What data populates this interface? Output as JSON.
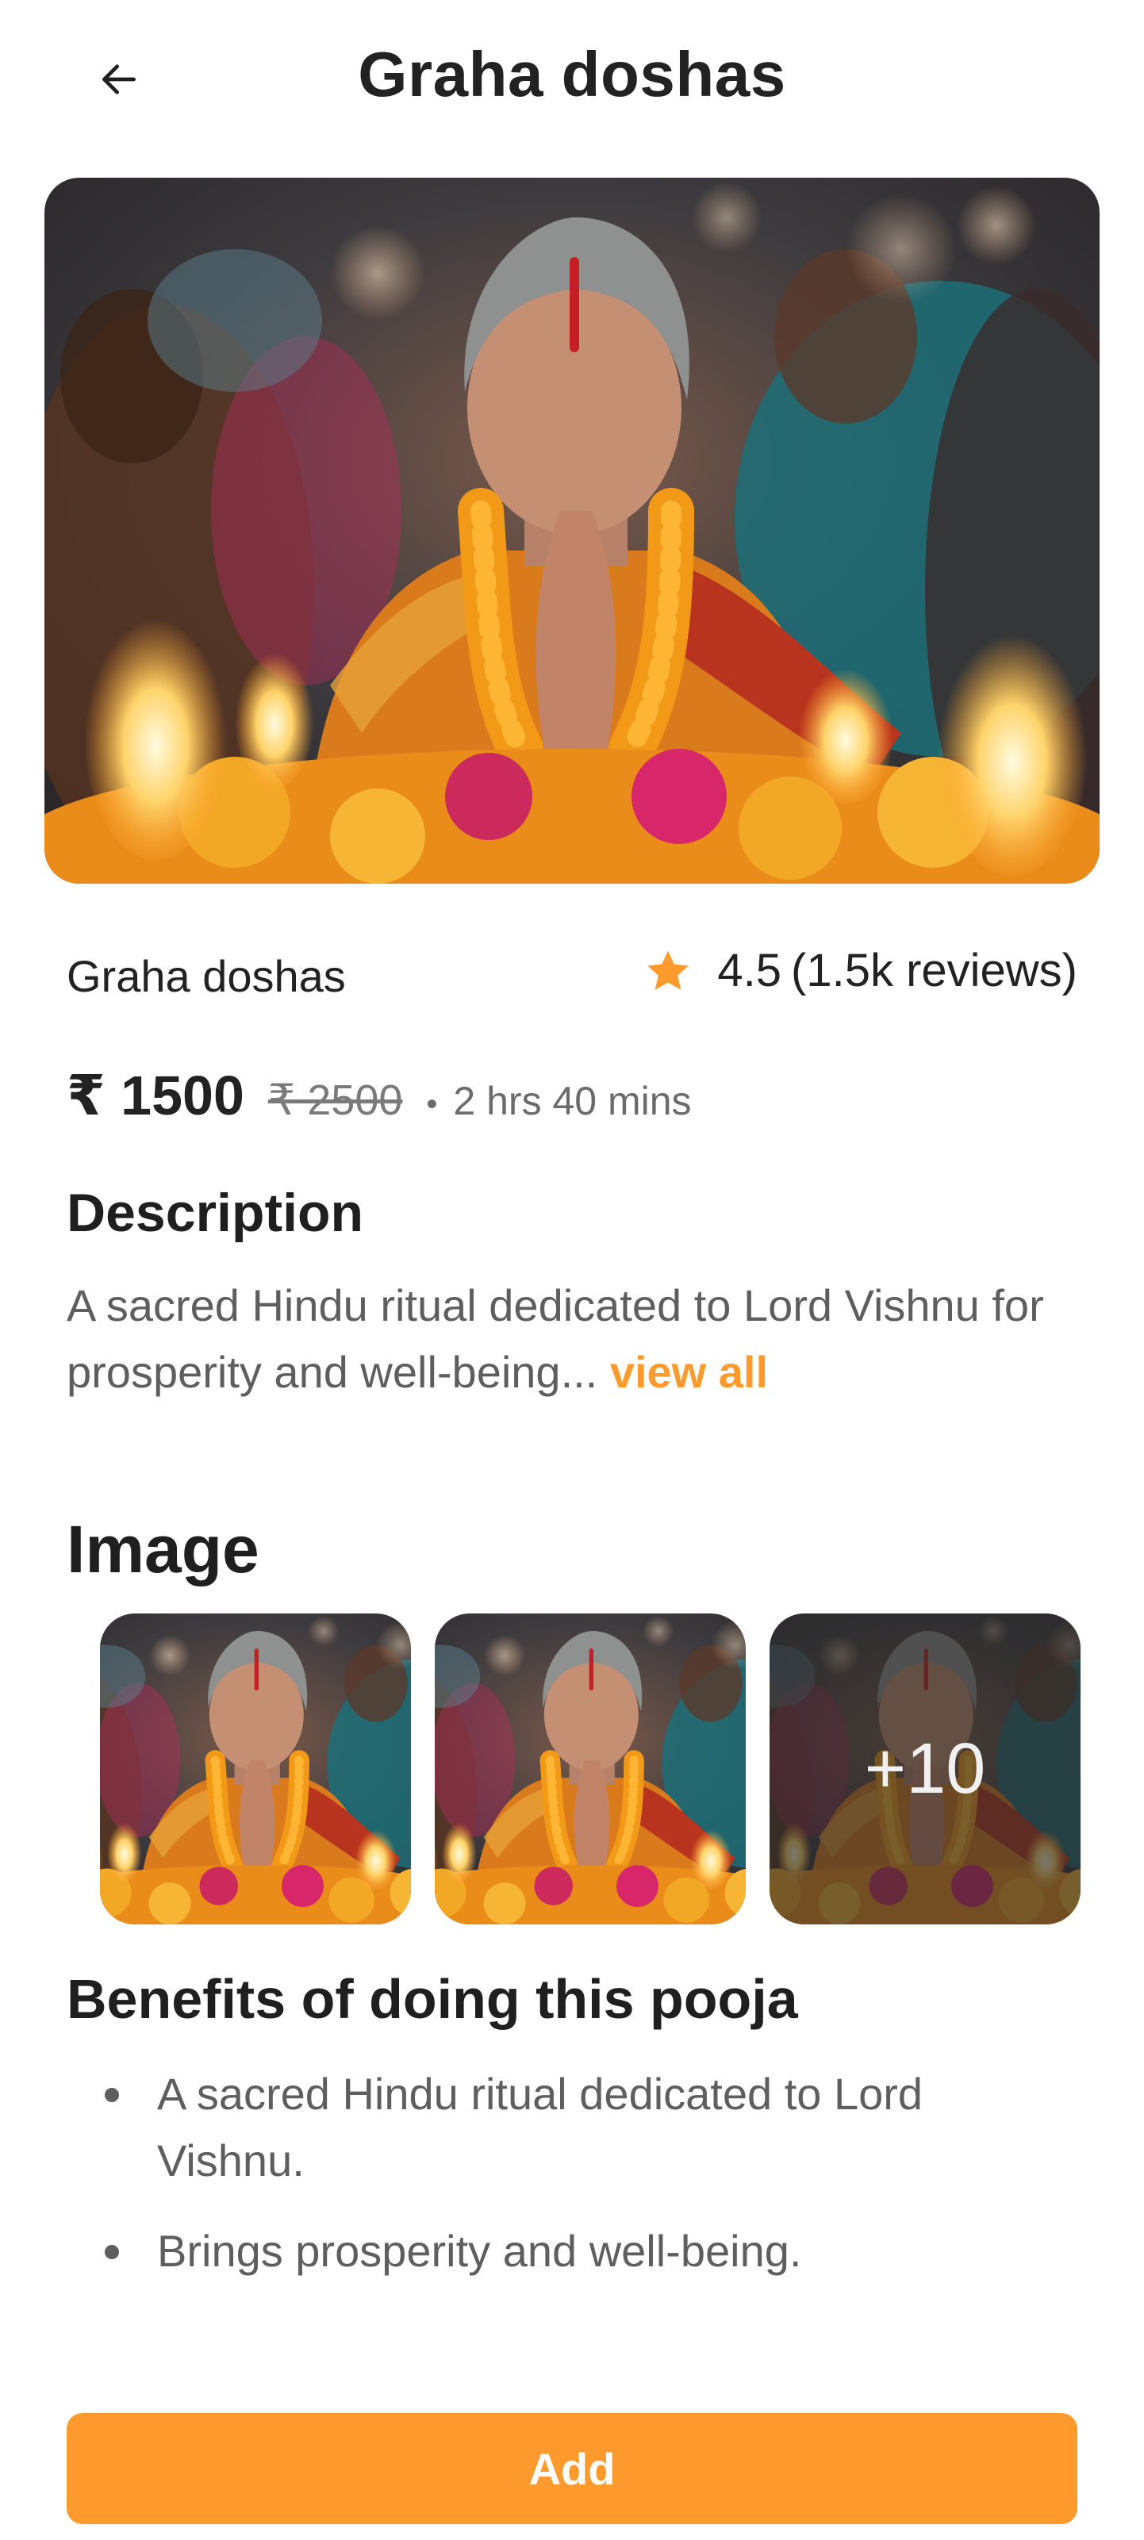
{
  "header": {
    "title": "Graha doshas",
    "back_icon": "arrow-left-icon"
  },
  "service": {
    "name": "Graha doshas",
    "rating": "4.5",
    "reviews": "(1.5k reviews)",
    "rating_icon": "star-icon",
    "price": "₹ 1500",
    "original_price": "₹ 2500",
    "duration": "2 hrs 40 mins"
  },
  "description": {
    "heading": "Description",
    "text": "A sacred Hindu ritual dedicated to Lord Vishnu for prosperity and well-being...",
    "link": "view all"
  },
  "gallery": {
    "heading": "Image",
    "more": "+10"
  },
  "benefits": {
    "heading": "Benefits of doing this pooja",
    "items": [
      "A sacred Hindu ritual dedicated to Lord Vishnu.",
      "Brings prosperity and well-being."
    ]
  },
  "actions": {
    "add": "Add"
  },
  "colors": {
    "accent": "#ff9a2e",
    "text_primary": "#222222",
    "text_secondary": "#5e5e5e"
  }
}
